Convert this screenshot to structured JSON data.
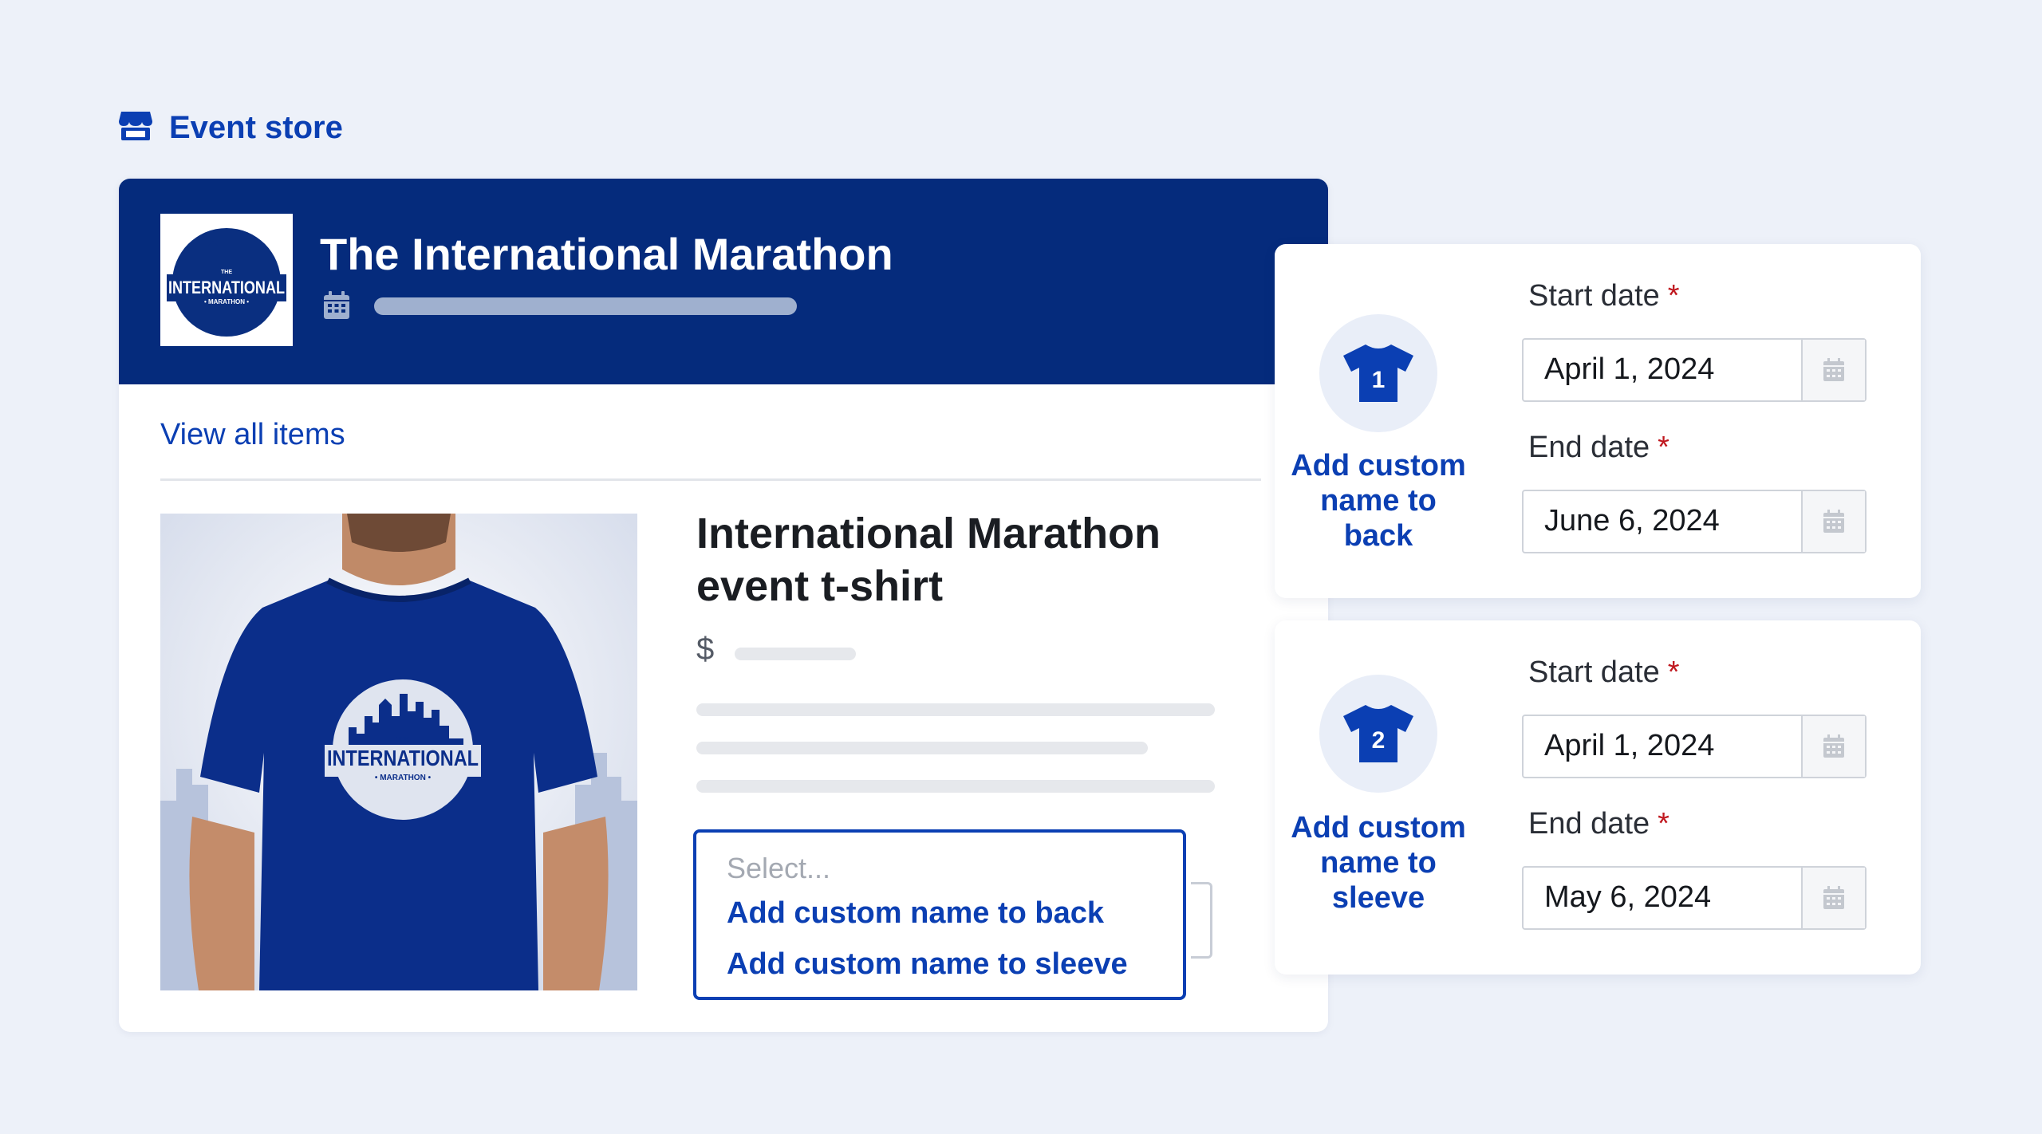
{
  "header": {
    "label": "Event store",
    "icon": "store-icon"
  },
  "store": {
    "title": "The International Marathon",
    "logo_text": {
      "top": "THE",
      "main": "INTERNATIONAL",
      "bottom": "• MARATHON •"
    },
    "view_all": "View all items"
  },
  "product": {
    "title": "International Marathon event t-shirt",
    "price_symbol": "$",
    "select": {
      "placeholder": "Select...",
      "options": [
        "Add custom name to back",
        "Add custom name to sleeve"
      ]
    }
  },
  "options_panels": [
    {
      "number": "1",
      "caption": "Add custom name to back",
      "start_label": "Start date",
      "start_value": "April 1, 2024",
      "end_label": "End date",
      "end_value": "June 6, 2024"
    },
    {
      "number": "2",
      "caption": "Add custom name to sleeve",
      "start_label": "Start date",
      "start_value": "April 1, 2024",
      "end_label": "End date",
      "end_value": "May 6, 2024"
    }
  ],
  "required_marker": "*",
  "colors": {
    "brand_blue": "#0b3fb3",
    "banner_navy": "#052b7c",
    "background": "#edf1f9",
    "required_red": "#c0181f"
  }
}
